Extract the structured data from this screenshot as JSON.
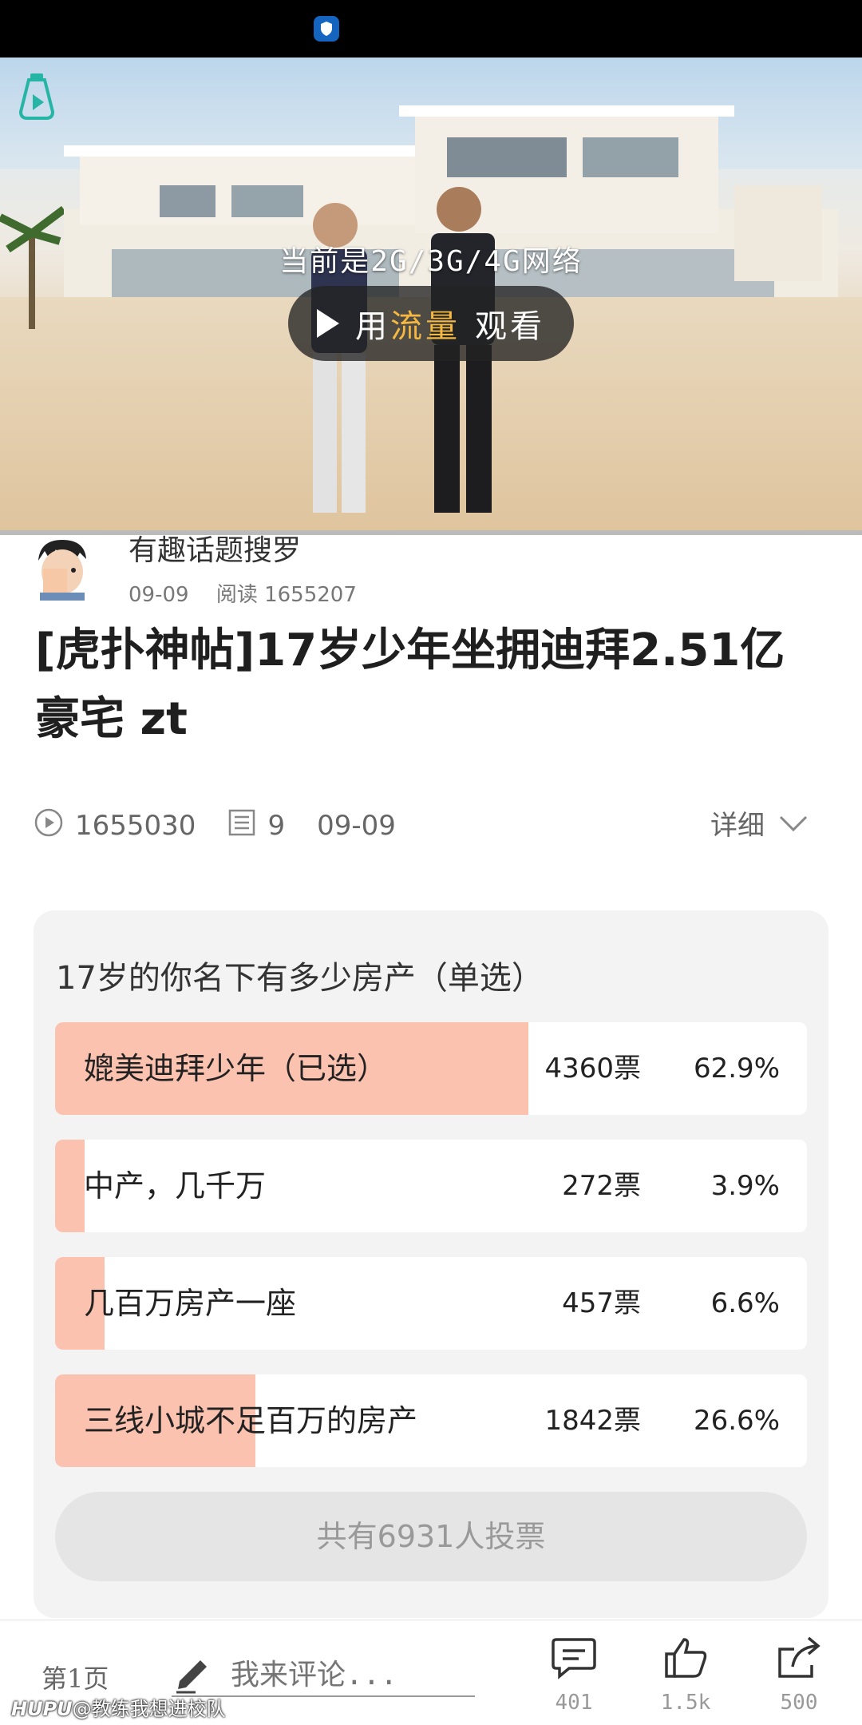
{
  "video": {
    "network_hint": "当前是2G/3G/4G网络",
    "play_button": {
      "prefix": "用",
      "accent": "流量",
      "suffix": "观看"
    }
  },
  "author": {
    "name": "有趣话题搜罗",
    "date": "09-09",
    "reads": "阅读 1655207"
  },
  "post": {
    "title": "[虎扑神帖]17岁少年坐拥迪拜2.51亿豪宅 zt"
  },
  "stats": {
    "views": "1655030",
    "comments": "9",
    "date": "09-09",
    "detail_label": "详细"
  },
  "poll": {
    "question": "17岁的你名下有多少房产（单选）",
    "options": [
      {
        "label": "媲美迪拜少年（已选）",
        "votes": "4360票",
        "percent": "62.9%",
        "fraction": 0.629
      },
      {
        "label": "中产，几千万",
        "votes": "272票",
        "percent": "3.9%",
        "fraction": 0.039
      },
      {
        "label": "几百万房产一座",
        "votes": "457票",
        "percent": "6.6%",
        "fraction": 0.066
      },
      {
        "label": "三线小城不足百万的房产",
        "votes": "1842票",
        "percent": "26.6%",
        "fraction": 0.266
      }
    ],
    "total": "共有6931人投票"
  },
  "bottom_bar": {
    "page": "第1页",
    "comment_placeholder": "我来评论...",
    "comment_count": "401",
    "like_count": "1.5k",
    "share_count": "500"
  },
  "watermark": {
    "brand": "HUPU",
    "user": "@教练我想进校队"
  },
  "colors": {
    "poll_fill": "#fcc2b0",
    "play_accent": "#f5b942",
    "app_logo": "#26b5a5"
  }
}
